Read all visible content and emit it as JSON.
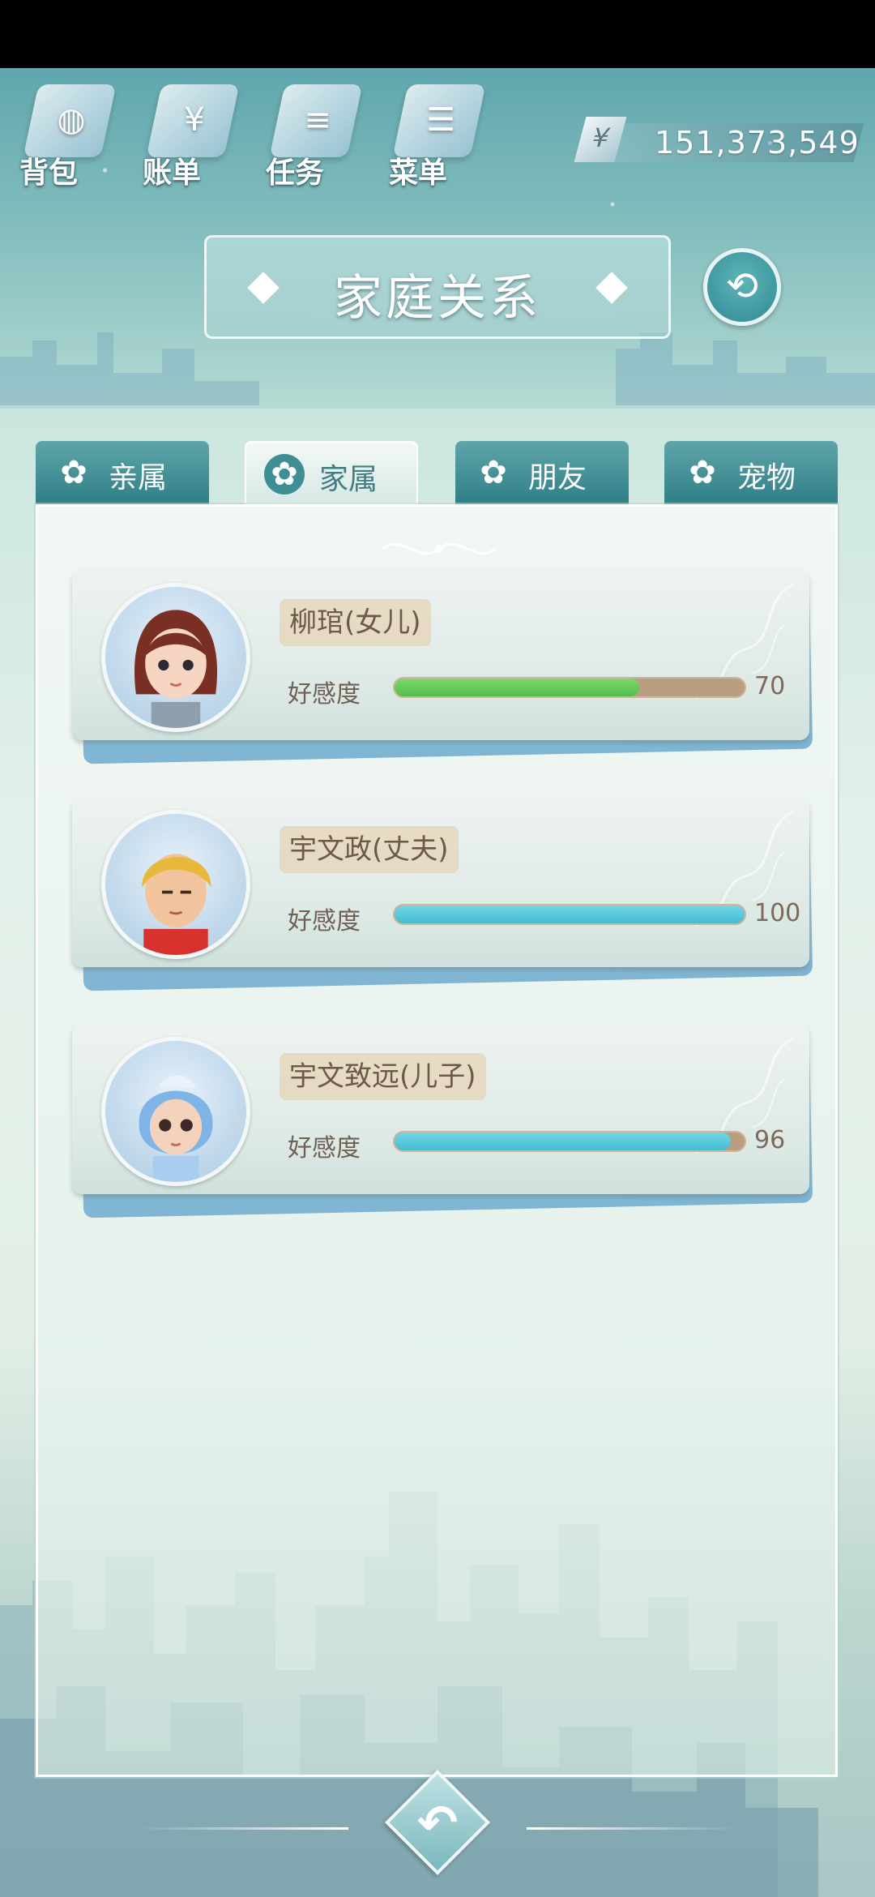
{
  "top_nav": [
    {
      "label": "背包",
      "icon": "bag-icon"
    },
    {
      "label": "账单",
      "icon": "bill-icon"
    },
    {
      "label": "任务",
      "icon": "task-icon"
    },
    {
      "label": "菜单",
      "icon": "menu-icon"
    }
  ],
  "money": {
    "symbol": "¥",
    "value": "151,373,549"
  },
  "title": "家庭关系",
  "tabs": [
    {
      "label": "亲属",
      "active": false
    },
    {
      "label": "家属",
      "active": true
    },
    {
      "label": "朋友",
      "active": false
    },
    {
      "label": "宠物",
      "active": false
    }
  ],
  "favor_label": "好感度",
  "members": [
    {
      "name": "柳琯(女儿)",
      "favor": 70,
      "favor_display": "70",
      "bar_color": "#4fbe4a"
    },
    {
      "name": "宇文政(丈夫)",
      "favor": 100,
      "favor_display": "100",
      "bar_color": "#44bcd2"
    },
    {
      "name": "宇文致远(儿子)",
      "favor": 96,
      "favor_display": "96",
      "bar_color": "#44bcd2"
    }
  ],
  "colors": {
    "accent": "#3f8e93",
    "panel": "#eef3f0",
    "bar_track": "#b99d80"
  }
}
